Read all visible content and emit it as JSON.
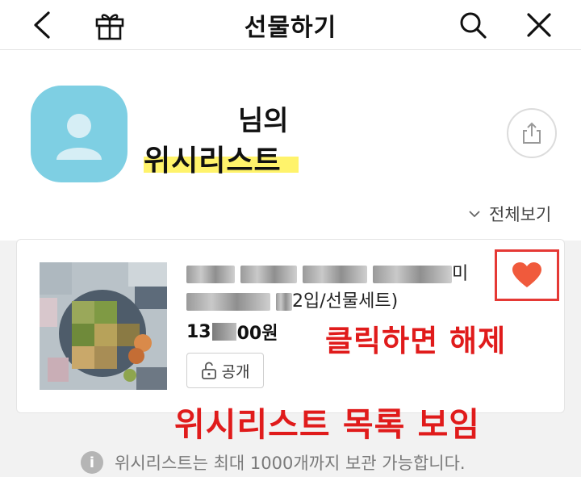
{
  "header": {
    "title": "선물하기",
    "icons": [
      "back-icon",
      "gift-icon",
      "search-icon",
      "close-icon"
    ]
  },
  "profile": {
    "owner_suffix": "님의",
    "wishlist_title": "위시리스트",
    "view_all": "전체보기"
  },
  "item": {
    "name_tail_1": "미",
    "name_tail_2": "2입/선물세트)",
    "price_prefix": "13",
    "price_suffix": "00원",
    "visibility": "공개",
    "wishlisted": true
  },
  "annotations": {
    "heart_note": "클릭하면 해제",
    "list_note": "위시리스트 목록 보임"
  },
  "footer": {
    "note": "위시리스트는 최대 1000개까지 보관 가능합니다."
  },
  "colors": {
    "avatar_bg": "#7ecfe3",
    "highlight": "#fff36b",
    "heart": "#f05a3c",
    "annotation_red": "#e01b1b"
  }
}
